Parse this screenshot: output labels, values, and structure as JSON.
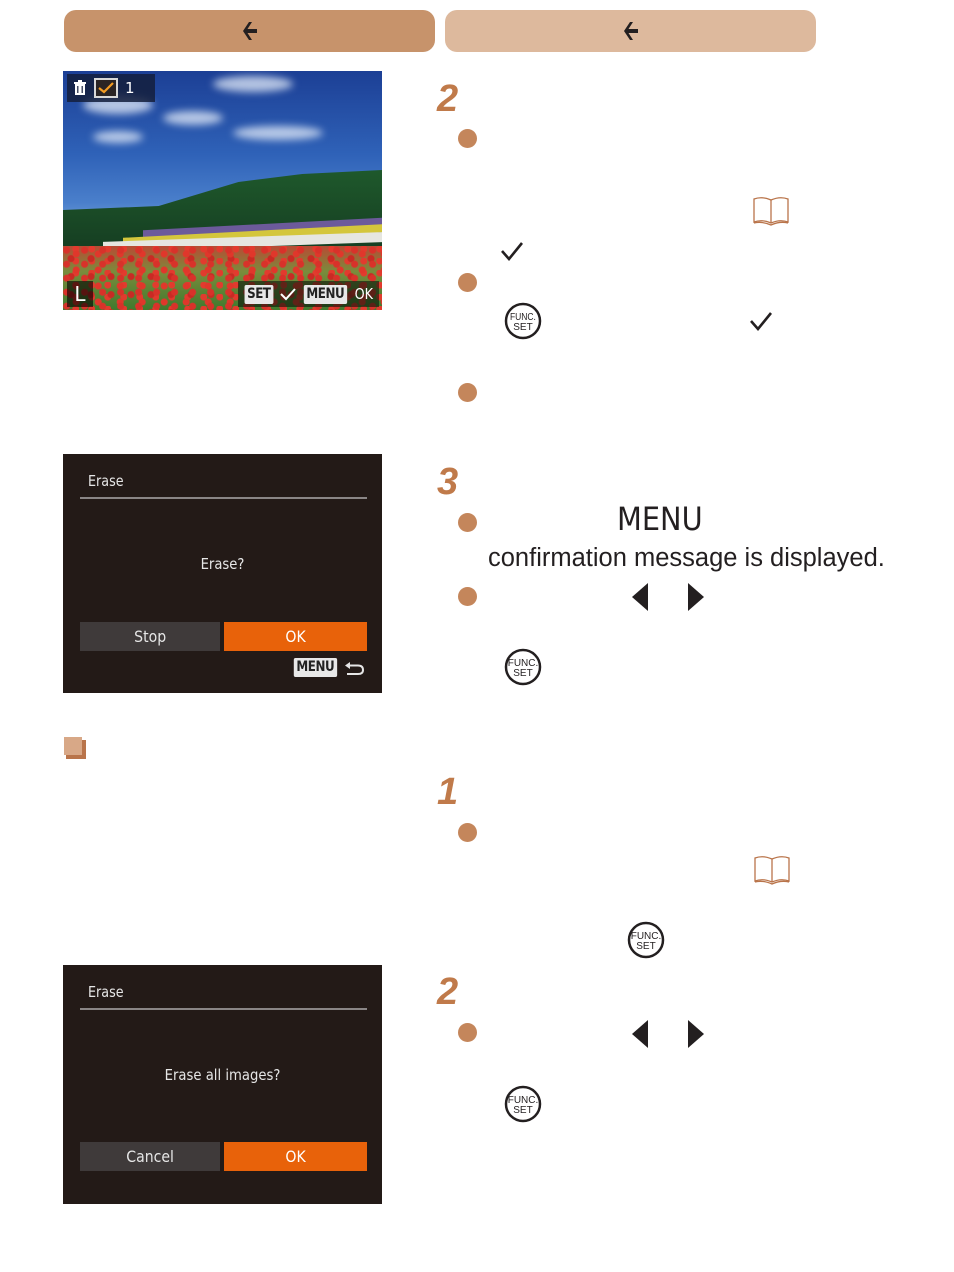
{
  "nav": {
    "back_icon": "arrow-left-icon",
    "forward_icon": "arrow-left-icon",
    "colors": {
      "primary": "#c7936b",
      "secondary": "#ddb99d"
    }
  },
  "photo_screen": {
    "erase_icon": "trash-icon",
    "selected_icon": "checkbox-checked-icon",
    "selected_count": "1",
    "image_size": "L",
    "set_key": "SET",
    "set_action_icon": "check-icon",
    "menu_key": "MENU",
    "menu_action": "OK"
  },
  "dialog_erase": {
    "title": "Erase",
    "message": "Erase?",
    "button_left": "Stop",
    "button_ok": "OK",
    "menu_key": "MENU",
    "menu_action_icon": "return-icon"
  },
  "dialog_erase_all": {
    "title": "Erase",
    "message": "Erase all images?",
    "button_left": "Cancel",
    "button_ok": "OK"
  },
  "steps": [
    {
      "number": "2",
      "icons": [
        "bullet",
        "book-ref-icon",
        "check-icon",
        "bullet",
        "func-set-button-icon",
        "check-icon",
        "bullet"
      ]
    },
    {
      "number": "3",
      "menu_label": "MENU",
      "text": "confirmation message is displayed.",
      "icons": [
        "bullet",
        "bullet",
        "left-arrow-icon",
        "right-arrow-icon",
        "func-set-button-icon"
      ]
    },
    {
      "number": "1",
      "icons": [
        "bullet",
        "book-ref-icon",
        "func-set-button-icon"
      ]
    },
    {
      "number": "2",
      "icons": [
        "bullet",
        "left-arrow-icon",
        "right-arrow-icon",
        "func-set-button-icon"
      ]
    }
  ],
  "func_set": {
    "line1": "FUNC.",
    "line2": "SET"
  },
  "accent_color": "#c07a4a",
  "ok_button_color": "#e8620a"
}
